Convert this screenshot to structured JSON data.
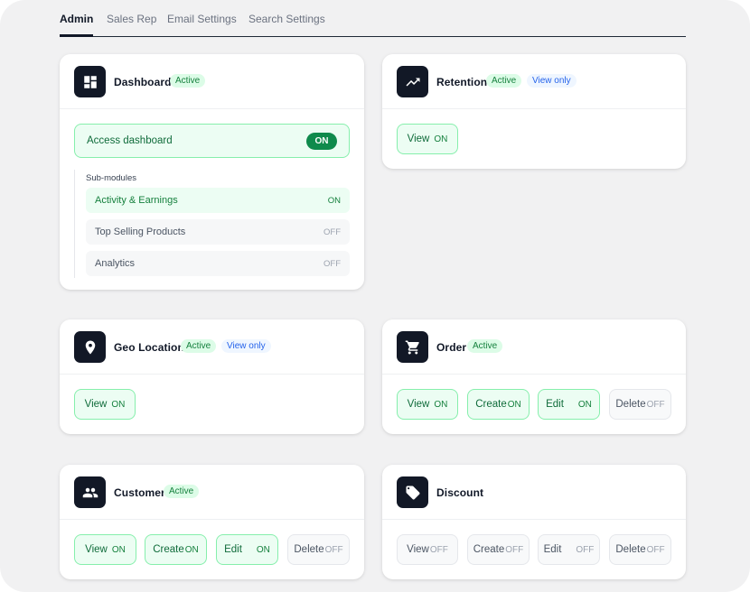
{
  "tabs": [
    "Admin",
    "Sales Rep",
    "Email Settings",
    "Search Settings"
  ],
  "badges": {
    "active": "Active",
    "view_only": "View only"
  },
  "dashboard": {
    "title": "Dashboard",
    "access_label": "Access dashboard",
    "access_state": "ON",
    "submodules_title": "Sub-modules",
    "submodules": [
      {
        "label": "Activity & Earnings",
        "state": "ON"
      },
      {
        "label": "Top Selling Products",
        "state": "OFF"
      },
      {
        "label": "Analytics",
        "state": "OFF"
      }
    ]
  },
  "retention": {
    "title": "Retention",
    "perms": [
      {
        "label": "View",
        "state": "ON"
      }
    ]
  },
  "geo": {
    "title": "Geo Location",
    "perms": [
      {
        "label": "View",
        "state": "ON"
      }
    ]
  },
  "order": {
    "title": "Order",
    "perms": [
      {
        "label": "View",
        "state": "ON"
      },
      {
        "label": "Create",
        "state": "ON"
      },
      {
        "label": "Edit",
        "state": "ON"
      },
      {
        "label": "Delete",
        "state": "OFF"
      }
    ]
  },
  "customer": {
    "title": "Customer",
    "perms": [
      {
        "label": "View",
        "state": "ON"
      },
      {
        "label": "Create",
        "state": "ON"
      },
      {
        "label": "Edit",
        "state": "ON"
      },
      {
        "label": "Delete",
        "state": "OFF"
      }
    ]
  },
  "discount": {
    "title": "Discount",
    "perms": [
      {
        "label": "View",
        "state": "OFF"
      },
      {
        "label": "Create",
        "state": "OFF"
      },
      {
        "label": "Edit",
        "state": "OFF"
      },
      {
        "label": "Delete",
        "state": "OFF"
      }
    ]
  },
  "icons": {
    "dashboard": "dashboard-icon",
    "retention": "trending-up-icon",
    "geo": "location-pin-icon",
    "order": "shopping-cart-icon",
    "customer": "people-icon",
    "discount": "tag-icon"
  },
  "colors": {
    "accent_green": "#15803d",
    "on_bg": "#ecfdf3",
    "dark_icon_bg": "#121826",
    "view_blue": "#2563eb"
  }
}
